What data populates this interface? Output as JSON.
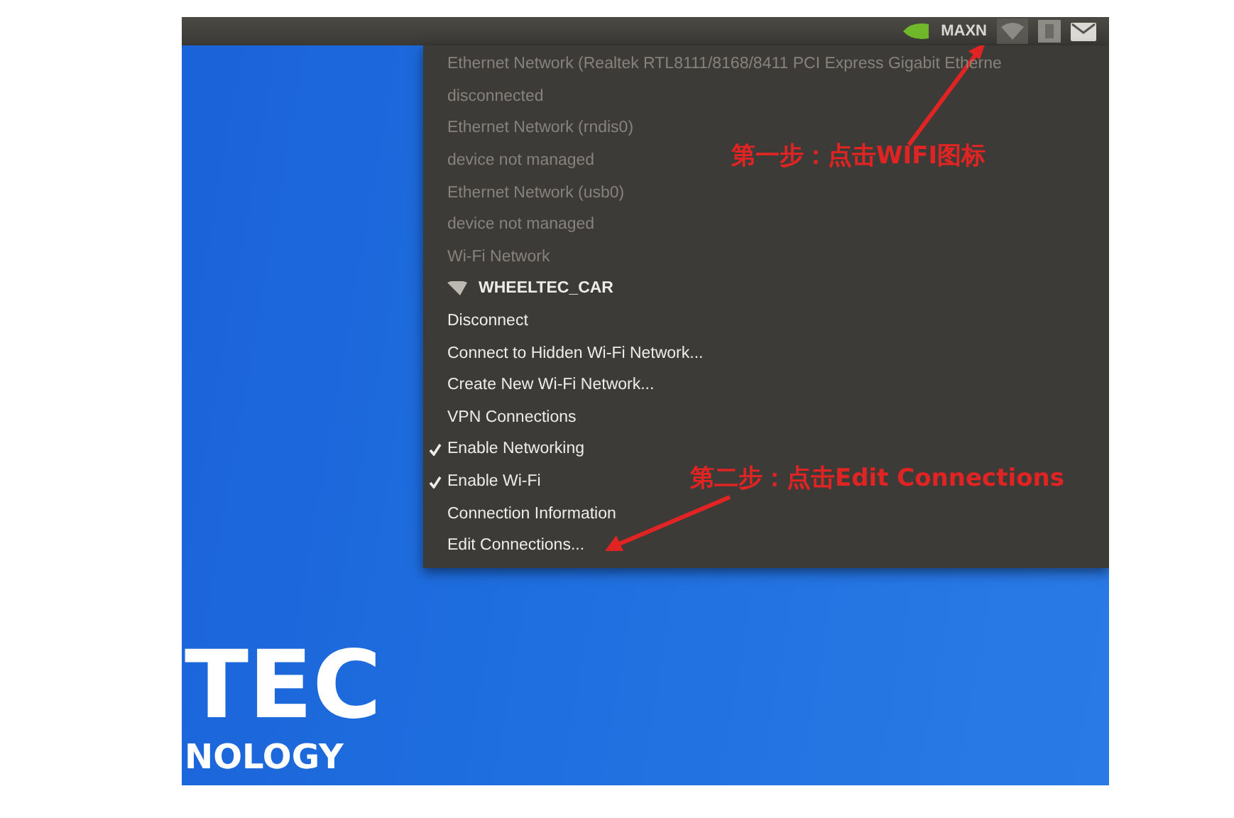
{
  "top_bar": {
    "power_mode": "MAXN",
    "wifi_selected": true
  },
  "menu": {
    "items": [
      {
        "kind": "header",
        "label": "Ethernet Network (Realtek RTL8111/8168/8411 PCI Express Gigabit Etherne",
        "disabled": true,
        "checked": false
      },
      {
        "kind": "header",
        "label": "disconnected",
        "disabled": true,
        "checked": false
      },
      {
        "kind": "header",
        "label": "Ethernet Network (rndis0)",
        "disabled": true,
        "checked": false
      },
      {
        "kind": "header",
        "label": "device not managed",
        "disabled": true,
        "checked": false
      },
      {
        "kind": "header",
        "label": "Ethernet Network (usb0)",
        "disabled": true,
        "checked": false
      },
      {
        "kind": "header",
        "label": "device not managed",
        "disabled": true,
        "checked": false
      },
      {
        "kind": "header",
        "label": "Wi-Fi Network",
        "disabled": true,
        "checked": false
      },
      {
        "kind": "network",
        "label": "WHEELTEC_CAR",
        "disabled": false,
        "checked": false
      },
      {
        "kind": "action",
        "label": "Disconnect",
        "disabled": false,
        "checked": false
      },
      {
        "kind": "action",
        "label": "Connect to Hidden Wi-Fi Network...",
        "disabled": false,
        "checked": false
      },
      {
        "kind": "action",
        "label": "Create New Wi-Fi Network...",
        "disabled": false,
        "checked": false
      },
      {
        "kind": "action",
        "label": "VPN Connections",
        "disabled": false,
        "checked": false
      },
      {
        "kind": "toggle",
        "label": "Enable Networking",
        "disabled": false,
        "checked": true
      },
      {
        "kind": "toggle",
        "label": "Enable Wi-Fi",
        "disabled": false,
        "checked": true
      },
      {
        "kind": "action",
        "label": "Connection Information",
        "disabled": false,
        "checked": false
      },
      {
        "kind": "action",
        "label": "Edit Connections...",
        "disabled": false,
        "checked": false
      }
    ]
  },
  "annotations": [
    {
      "text": "第一步：点击WIFI图标"
    },
    {
      "text": "第二步：点击Edit Connections"
    }
  ],
  "logo": {
    "title": "TEC",
    "subtitle": "NOLOGY"
  }
}
